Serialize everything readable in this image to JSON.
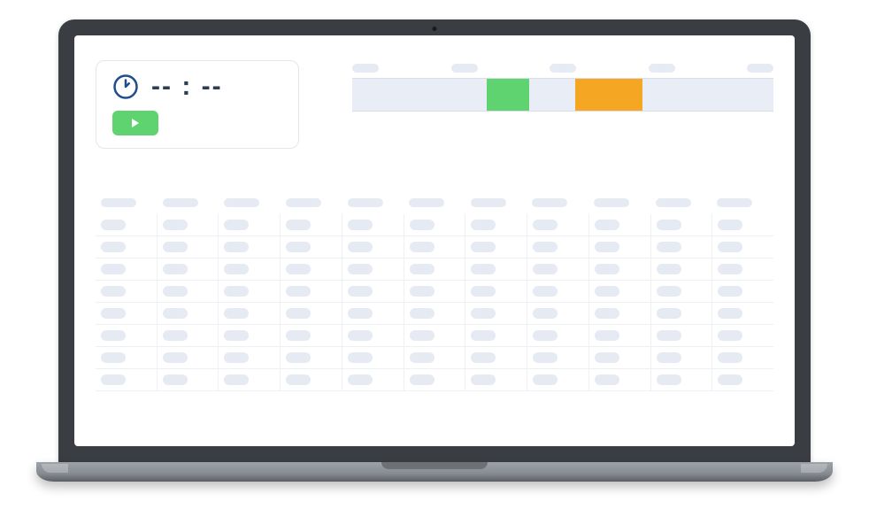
{
  "timer": {
    "display": "-- : --",
    "icon": "clock-icon",
    "play_action": "play-icon"
  },
  "timeline": {
    "segments": [
      {
        "color": "green",
        "left_pct": 32,
        "width_pct": 10
      },
      {
        "color": "orange",
        "left_pct": 53,
        "width_pct": 16
      }
    ],
    "label_count": 5
  },
  "table": {
    "columns": 11,
    "rows": 8
  },
  "colors": {
    "accent_green": "#5fd370",
    "accent_orange": "#f5a623",
    "placeholder": "#e6eaf3",
    "track_bg": "#e9edf6",
    "clock_stroke": "#1f4d8f"
  }
}
